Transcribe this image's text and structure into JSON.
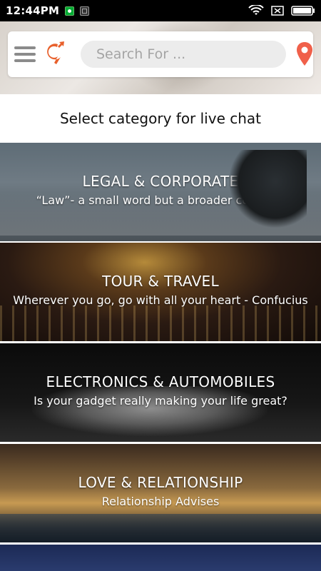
{
  "status_bar": {
    "time": "12:44PM"
  },
  "search": {
    "placeholder": "Search For ..."
  },
  "page": {
    "heading": "Select category for live chat"
  },
  "categories": [
    {
      "title": "LEGAL & CORPORATE",
      "subtitle": "“Law”- a small word but a broader concept."
    },
    {
      "title": "TOUR & TRAVEL",
      "subtitle": "Wherever you go, go with all your heart - Confucius"
    },
    {
      "title": "ELECTRONICS & AUTOMOBILES",
      "subtitle": "Is your gadget really making your life great?"
    },
    {
      "title": "LOVE & RELATIONSHIP",
      "subtitle": "Relationship Advises"
    }
  ],
  "colors": {
    "pin": "#f0604a",
    "logo": "#e8602c"
  }
}
